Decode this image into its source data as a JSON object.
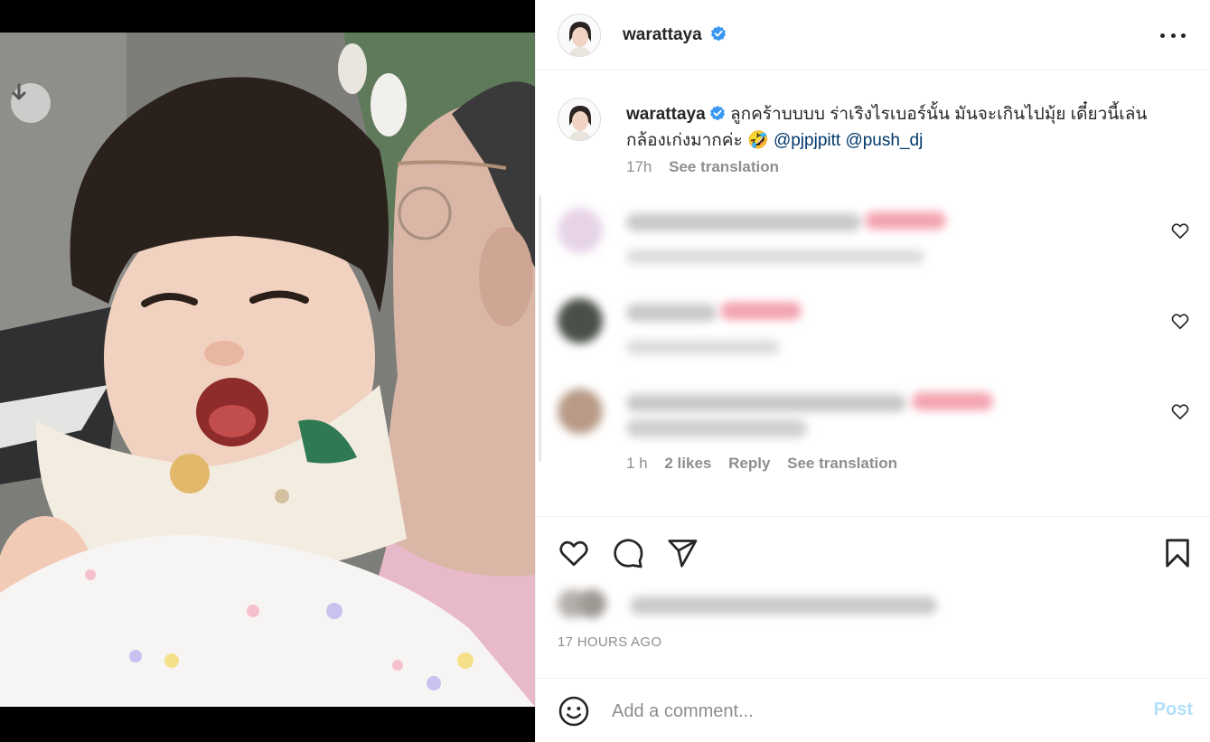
{
  "post": {
    "username": "warattaya",
    "verified": true,
    "more_icon": "more-horizontal-icon",
    "caption": {
      "text": "ลูกคร้าบบบบ ร่าเริงไรเบอร์นั้น มันจะเกินไปมุ้ย เดี๋ยวนี้เล่นกล้องเก่งมากค่ะ 🤣",
      "mention_1": "@pjpjpitt",
      "mention_2": "@push_dj",
      "time": "17h",
      "see_translation": "See translation"
    }
  },
  "comments": [
    {
      "blurred": true,
      "accent_color": "#f4a3b0",
      "like_icon": "heart-outline-icon"
    },
    {
      "blurred": true,
      "accent_color": "#f4a3b0",
      "like_icon": "heart-outline-icon"
    },
    {
      "blurred": true,
      "accent_color": "#f4a3b0",
      "like_icon": "heart-outline-icon",
      "time": "1 h",
      "likes": "2 likes",
      "reply": "Reply",
      "see_translation": "See translation"
    }
  ],
  "actions": {
    "like_icon": "heart-outline-icon",
    "comment_icon": "speech-bubble-icon",
    "share_icon": "paper-plane-icon",
    "save_icon": "bookmark-icon"
  },
  "timestamp": "17 HOURS AGO",
  "add_comment": {
    "emoji_icon": "smiley-icon",
    "placeholder": "Add a comment...",
    "post_label": "Post"
  },
  "media": {
    "download_icon": "download-arrow-icon"
  },
  "colors": {
    "link": "#00376b",
    "verified_blue": "#3897f0",
    "muted": "#8e8e8e",
    "post_disabled": "#b2dffc"
  }
}
